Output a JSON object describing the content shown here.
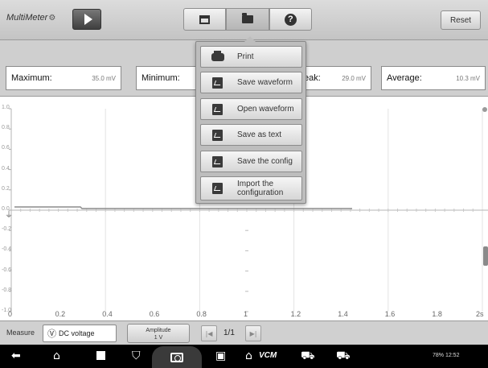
{
  "app": {
    "title": "MultiMeter",
    "title_icon": "gear-icon"
  },
  "toolbar": {
    "play_icon": "play-icon",
    "screen_icon": "screen-icon",
    "folder_icon": "folder-icon",
    "help_icon": "help-icon",
    "help_glyph": "?",
    "reset_label": "Reset"
  },
  "stats": {
    "maximum": {
      "label": "Maximum:",
      "value": "35.0 mV"
    },
    "minimum": {
      "label": "Minimum:",
      "value": ""
    },
    "peak": {
      "label": "eak:",
      "value": "29.0 mV"
    },
    "average": {
      "label": "Average:",
      "value": "10.3 mV"
    }
  },
  "menu": {
    "items": [
      {
        "label": "Print",
        "icon": "printer-icon"
      },
      {
        "label": "Save waveform",
        "icon": "save-waveform-icon"
      },
      {
        "label": "Open waveform",
        "icon": "open-waveform-icon"
      },
      {
        "label": "Save as text",
        "icon": "text-file-icon"
      },
      {
        "label": "Save the config",
        "icon": "save-config-icon"
      },
      {
        "label": "Import the configuration",
        "icon": "import-config-icon"
      }
    ]
  },
  "graph": {
    "y_ticks": [
      "1.0",
      "0.8",
      "0.6",
      "0.4",
      "0.2",
      "0.0",
      "-0.2",
      "-0.4",
      "-0.6",
      "-0.8",
      "-1.0"
    ],
    "x_ticks": [
      "0",
      "0.2",
      "0.4",
      "0.6",
      "0.8",
      "1",
      "1.2",
      "1.4",
      "1.6",
      "1.8",
      "2s"
    ],
    "trace_color": "#8c8c8c"
  },
  "controls": {
    "measure_label": "Measure",
    "mode_value": "DC voltage",
    "mode_icon": "voltmeter-icon",
    "amplitude_label": "Amplitude",
    "amplitude_value": "1 V",
    "page_indicator": "1/1"
  },
  "android_nav": {
    "icons": [
      "back-icon",
      "home-icon",
      "recents-icon",
      "vpn-icon",
      "camera-icon",
      "screenshot-icon",
      "autel-home-icon",
      "vcm-icon",
      "car-icon",
      "car-user-icon"
    ],
    "vcm_label": "VCM",
    "status": "78% 12:52"
  }
}
